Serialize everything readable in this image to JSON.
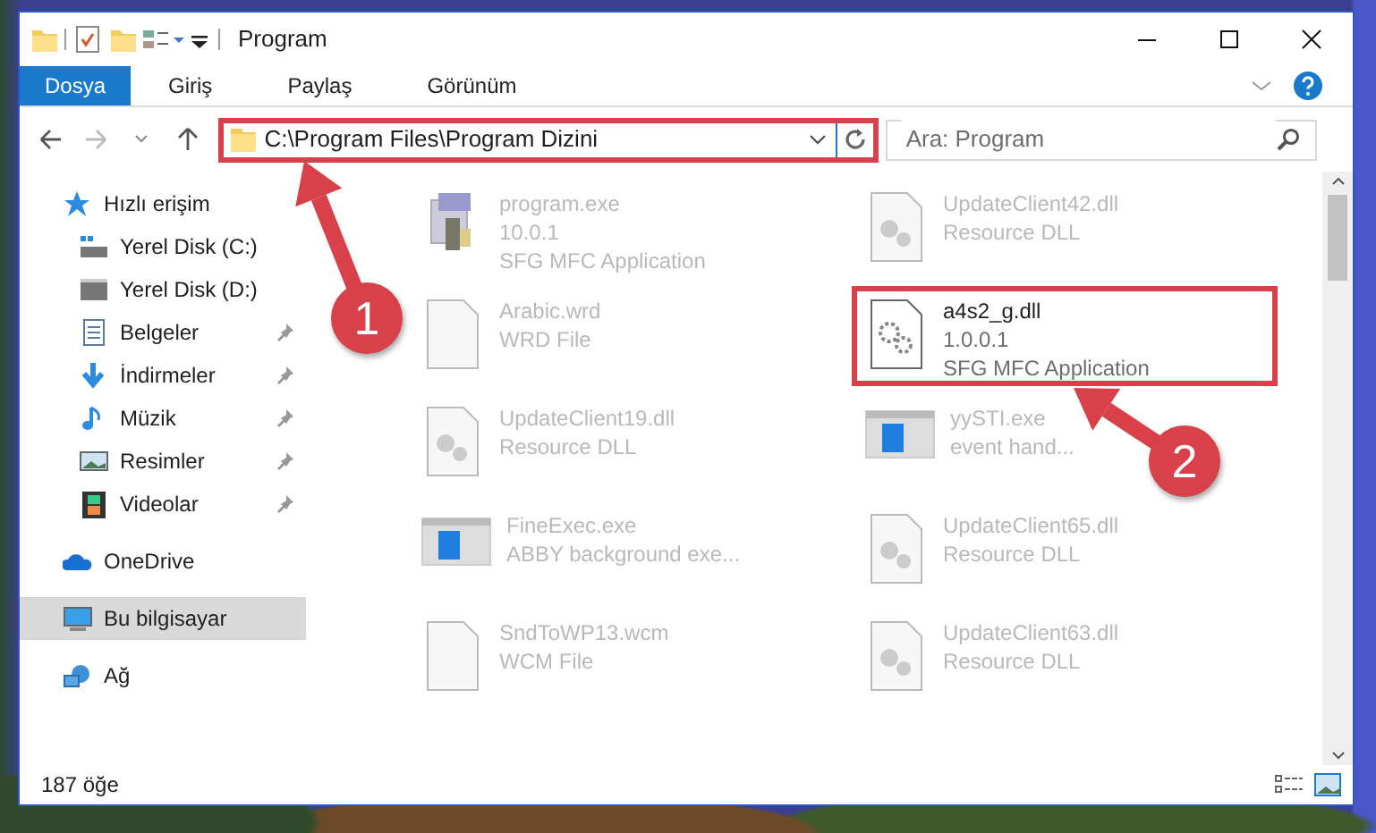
{
  "window": {
    "title": "Program"
  },
  "ribbon_tabs": [
    {
      "label": "Dosya",
      "selected": true
    },
    {
      "label": "Giriş",
      "selected": false
    },
    {
      "label": "Paylaş",
      "selected": false
    },
    {
      "label": "Görünüm",
      "selected": false
    }
  ],
  "address": {
    "path": "C:\\Program Files\\Program Dizini",
    "highlighted": true
  },
  "search": {
    "placeholder": "Ara: Program"
  },
  "sidebar": {
    "items": [
      {
        "label": "Hızlı erişim",
        "selected": false,
        "children": [
          {
            "label": "Yerel Disk (C:)",
            "selected": false,
            "pinned": false
          },
          {
            "label": "Yerel Disk (D:)",
            "selected": false,
            "pinned": false
          },
          {
            "label": "Belgeler",
            "selected": false,
            "pinned": true
          },
          {
            "label": "İndirmeler",
            "selected": false,
            "pinned": true
          },
          {
            "label": "Müzik",
            "selected": false,
            "pinned": true
          },
          {
            "label": "Resimler",
            "selected": false,
            "pinned": true
          },
          {
            "label": "Videolar",
            "selected": false,
            "pinned": true
          }
        ]
      },
      {
        "label": "OneDrive",
        "selected": false
      },
      {
        "label": "Bu bilgisayar",
        "selected": true
      },
      {
        "label": "Ağ",
        "selected": false
      }
    ]
  },
  "files": [
    {
      "kind": "exe",
      "name": "program.exe",
      "details": [
        "10.0.1",
        "SFG MFC Application"
      ],
      "blurred": true,
      "highlighted": false
    },
    {
      "kind": "dll",
      "name": "UpdateClient42.dll",
      "details": [
        "Resource DLL"
      ],
      "blurred": true,
      "highlighted": false
    },
    {
      "kind": "doc",
      "name": "Arabic.wrd",
      "details": [
        "WRD File"
      ],
      "blurred": true,
      "highlighted": false
    },
    {
      "kind": "gear",
      "name": "a4s2_g.dll",
      "details": [
        "1.0.0.1",
        "SFG MFC Application"
      ],
      "blurred": false,
      "highlighted": true
    },
    {
      "kind": "dll",
      "name": "UpdateClient19.dll",
      "details": [
        "Resource DLL"
      ],
      "blurred": true,
      "highlighted": false
    },
    {
      "kind": "app",
      "name": "yySTI.exe",
      "details": [
        "event hand..."
      ],
      "blurred": true,
      "highlighted": false
    },
    {
      "kind": "app",
      "name": "FineExec.exe",
      "details": [
        "ABBY background exe..."
      ],
      "blurred": true,
      "highlighted": false
    },
    {
      "kind": "dll",
      "name": "UpdateClient65.dll",
      "details": [
        "Resource DLL"
      ],
      "blurred": true,
      "highlighted": false
    },
    {
      "kind": "doc",
      "name": "SndToWP13.wcm",
      "details": [
        "WCM File"
      ],
      "blurred": true,
      "highlighted": false
    },
    {
      "kind": "dll",
      "name": "UpdateClient63.dll",
      "details": [
        "Resource DLL"
      ],
      "blurred": true,
      "highlighted": false
    }
  ],
  "status_bar": {
    "count": "187 öğe"
  },
  "annotations": [
    {
      "label": "1"
    },
    {
      "label": "2"
    }
  ]
}
